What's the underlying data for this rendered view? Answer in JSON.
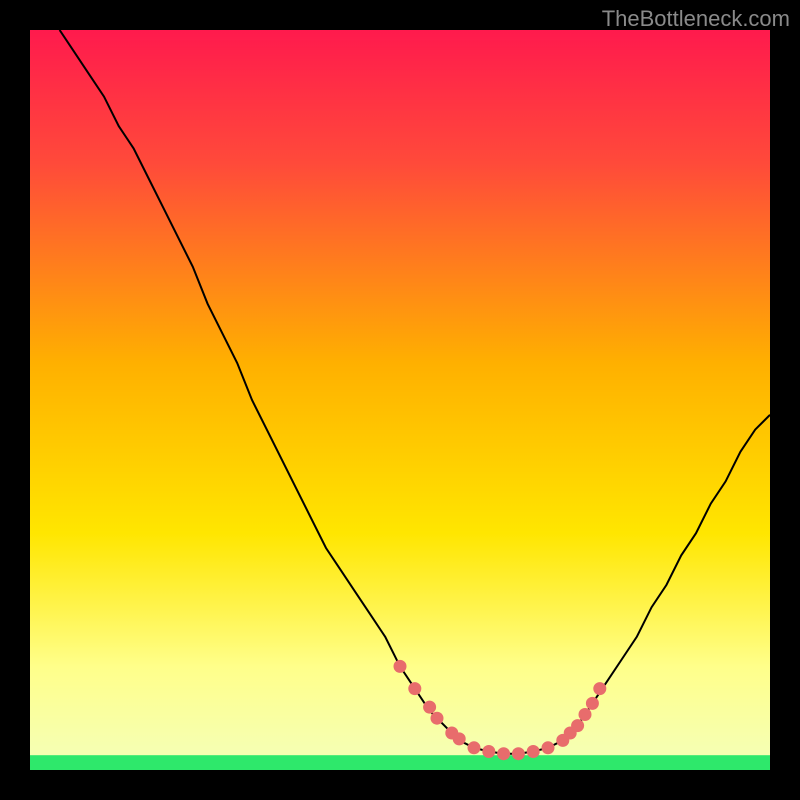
{
  "watermark": "TheBottleneck.com",
  "colors": {
    "curve": "#000000",
    "dots": "#e86c6c",
    "green_band": "#2ee86b",
    "gradient_top": "#ff1a4d",
    "gradient_mid": "#ffd400",
    "gradient_low": "#ffff8a"
  },
  "chart_data": {
    "type": "line",
    "title": "",
    "xlabel": "",
    "ylabel": "",
    "xlim": [
      0,
      100
    ],
    "ylim": [
      0,
      100
    ],
    "curve": {
      "x": [
        4,
        6,
        8,
        10,
        12,
        14,
        16,
        18,
        20,
        22,
        24,
        26,
        28,
        30,
        32,
        34,
        36,
        38,
        40,
        42,
        44,
        46,
        48,
        50,
        52,
        54,
        56,
        58,
        60,
        62,
        64,
        66,
        68,
        70,
        72,
        74,
        76,
        78,
        80,
        82,
        84,
        86,
        88,
        90,
        92,
        94,
        96,
        98,
        100
      ],
      "y": [
        100,
        97,
        94,
        91,
        87,
        84,
        80,
        76,
        72,
        68,
        63,
        59,
        55,
        50,
        46,
        42,
        38,
        34,
        30,
        27,
        24,
        21,
        18,
        14,
        11,
        8,
        6,
        4,
        3,
        2.5,
        2.2,
        2.2,
        2.5,
        3,
        4,
        6,
        9,
        12,
        15,
        18,
        22,
        25,
        29,
        32,
        36,
        39,
        43,
        46,
        48
      ]
    },
    "dots": {
      "x": [
        50,
        52,
        54,
        55,
        57,
        58,
        60,
        62,
        64,
        66,
        68,
        70,
        72,
        73,
        74,
        75,
        76,
        77
      ],
      "y": [
        14,
        11,
        8.5,
        7,
        5,
        4.2,
        3,
        2.5,
        2.2,
        2.2,
        2.5,
        3,
        4,
        5,
        6,
        7.5,
        9,
        11
      ]
    },
    "green_band": {
      "from_y": 0,
      "to_y": 2
    }
  }
}
